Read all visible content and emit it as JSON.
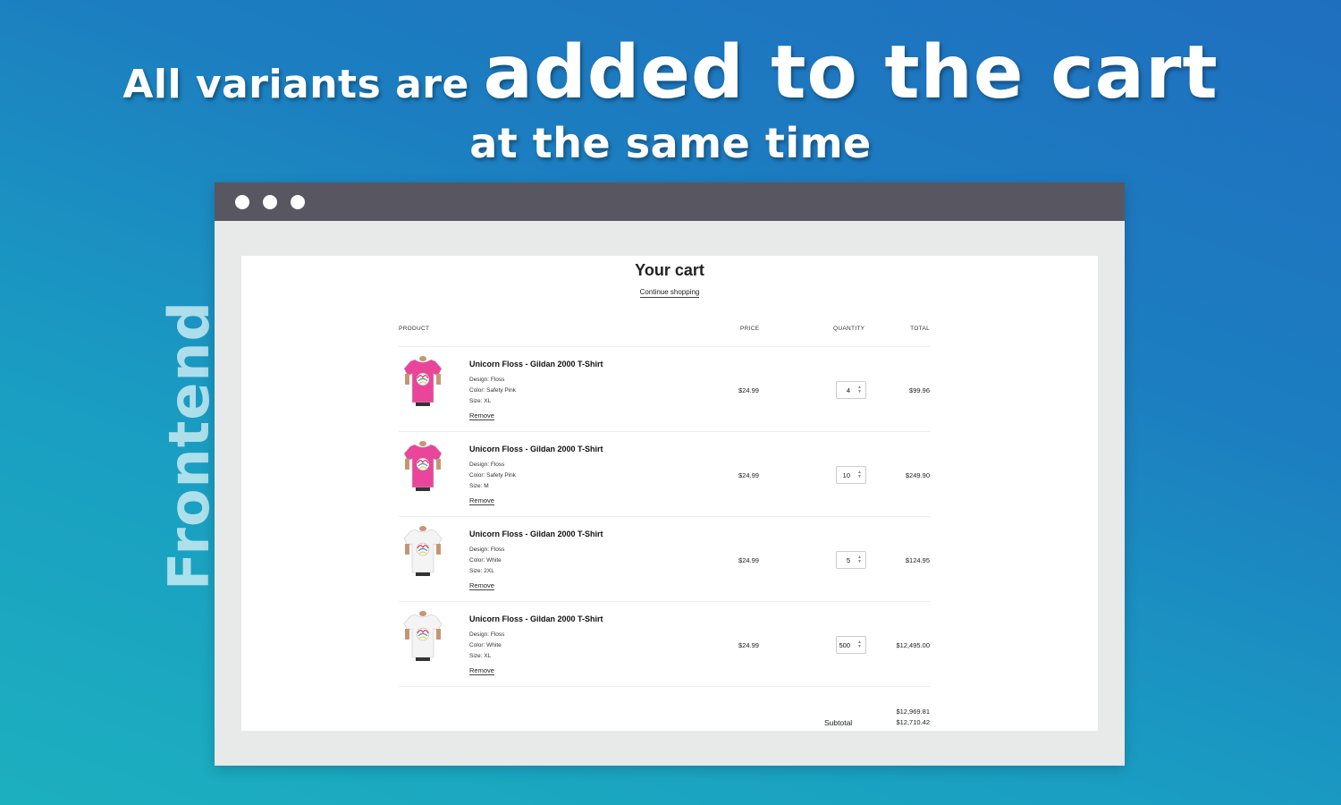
{
  "headline": {
    "part1": "All variants are",
    "part2": "added to the cart",
    "line2": "at the same time"
  },
  "side_label": "Frontend",
  "cart": {
    "title": "Your cart",
    "continue_label": "Continue shopping",
    "columns": {
      "product": "PRODUCT",
      "price": "PRICE",
      "quantity": "QUANTITY",
      "total": "TOTAL"
    },
    "items": [
      {
        "name": "Unicorn Floss - Gildan 2000 T-Shirt",
        "design": "Design: Floss",
        "color": "Color: Safety Pink",
        "size": "Size: XL",
        "remove": "Remove",
        "price": "$24.99",
        "quantity": "4",
        "total": "$99.96",
        "shirt_color": "#e9459a"
      },
      {
        "name": "Unicorn Floss - Gildan 2000 T-Shirt",
        "design": "Design: Floss",
        "color": "Color: Safety Pink",
        "size": "Size: M",
        "remove": "Remove",
        "price": "$24.99",
        "quantity": "10",
        "total": "$249.90",
        "shirt_color": "#e9459a"
      },
      {
        "name": "Unicorn Floss - Gildan 2000 T-Shirt",
        "design": "Design: Floss",
        "color": "Color: White",
        "size": "Size: 2XL",
        "remove": "Remove",
        "price": "$24.99",
        "quantity": "5",
        "total": "$124.95",
        "shirt_color": "#f4f4f4"
      },
      {
        "name": "Unicorn Floss - Gildan 2000 T-Shirt",
        "design": "Design: Floss",
        "color": "Color: White",
        "size": "Size: XL",
        "remove": "Remove",
        "price": "$24.99",
        "quantity": "500",
        "total": "$12,495.00",
        "shirt_color": "#f4f4f4"
      }
    ],
    "summary": {
      "original_total": "$12,969.81",
      "subtotal_label": "Subtotal",
      "subtotal": "$12,710.42"
    }
  },
  "colors": {
    "titlebar": "#585761",
    "browser_bg": "#e8e9e9",
    "bg_gradient_start": "#1cb0bf",
    "bg_gradient_end": "#1f6fbf"
  }
}
